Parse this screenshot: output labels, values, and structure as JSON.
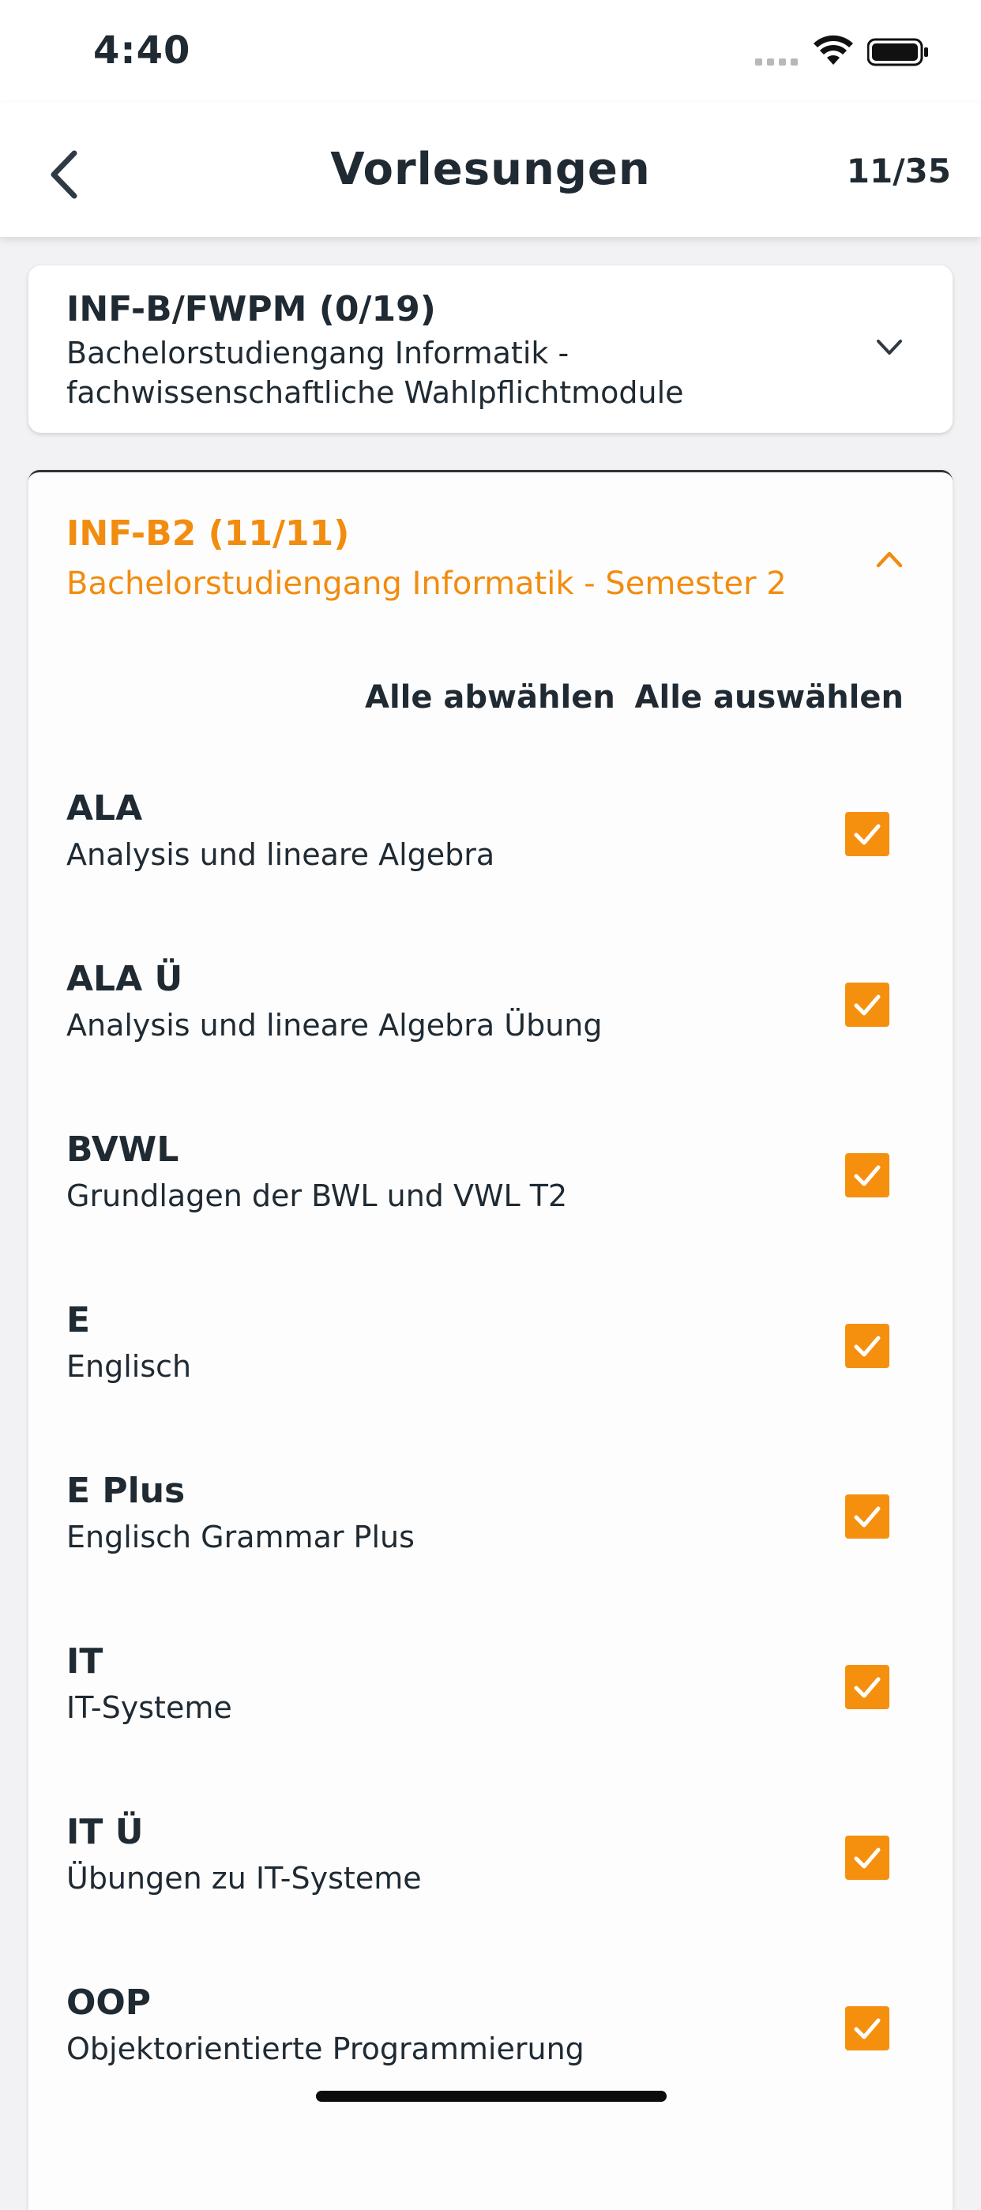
{
  "status_bar": {
    "time": "4:40"
  },
  "nav": {
    "title": "Vorlesungen",
    "count": "11/35"
  },
  "groups": [
    {
      "code": "INF-B/FWPM (0/19)",
      "description": "Bachelorstudiengang Informatik - fachwissenschaftliche Wahlpflichtmodule",
      "expanded": false
    },
    {
      "code": "INF-B2 (11/11)",
      "description": "Bachelorstudiengang Informatik - Semester 2",
      "expanded": true,
      "deselect_all": "Alle abwählen",
      "select_all": "Alle auswählen",
      "courses": [
        {
          "code": "ALA",
          "name": "Analysis und lineare Algebra",
          "checked": true
        },
        {
          "code": "ALA Ü",
          "name": "Analysis und lineare Algebra Übung",
          "checked": true
        },
        {
          "code": "BVWL",
          "name": "Grundlagen der BWL und VWL T2",
          "checked": true
        },
        {
          "code": "E",
          "name": "Englisch",
          "checked": true
        },
        {
          "code": "E Plus",
          "name": "Englisch Grammar Plus",
          "checked": true
        },
        {
          "code": "IT",
          "name": "IT-Systeme",
          "checked": true
        },
        {
          "code": "IT Ü",
          "name": "Übungen zu IT-Systeme",
          "checked": true
        },
        {
          "code": "OOP",
          "name": "Objektorientierte Programmierung",
          "checked": true
        }
      ]
    }
  ],
  "colors": {
    "accent": "#f5900f",
    "text": "#1f2a33"
  },
  "icons": {
    "back": "chevron-left-icon",
    "collapsed": "chevron-down-icon",
    "expanded": "chevron-up-icon",
    "checkbox": "check-icon"
  }
}
